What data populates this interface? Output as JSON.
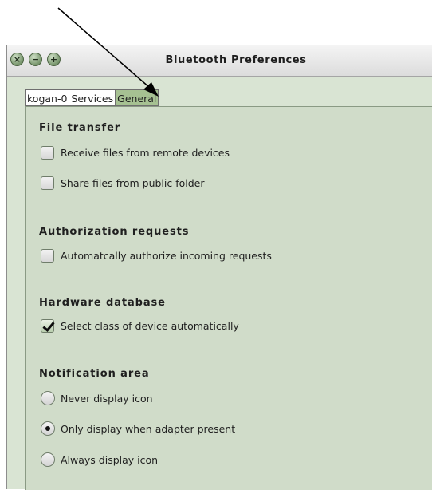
{
  "window": {
    "title": "Bluetooth Preferences",
    "buttons": {
      "close": "×",
      "minimize": "−",
      "maximize": "+"
    }
  },
  "tabs": [
    {
      "label": "kogan-0",
      "active": false
    },
    {
      "label": "Services",
      "active": false
    },
    {
      "label": "General",
      "active": true
    }
  ],
  "sections": {
    "file_transfer": {
      "title": "File transfer",
      "options": [
        {
          "label": "Receive files from remote devices",
          "checked": false
        },
        {
          "label": "Share files from public folder",
          "checked": false
        }
      ]
    },
    "authorization": {
      "title": "Authorization requests",
      "options": [
        {
          "label": "Automatcally authorize incoming requests",
          "checked": false
        }
      ]
    },
    "hardware": {
      "title": "Hardware database",
      "options": [
        {
          "label": "Select class of device automatically",
          "checked": true
        }
      ]
    },
    "notification": {
      "title": "Notification area",
      "options": [
        {
          "label": "Never display icon",
          "selected": false
        },
        {
          "label": "Only display when adapter present",
          "selected": true
        },
        {
          "label": "Always display icon",
          "selected": false
        }
      ]
    }
  },
  "colors": {
    "content_bg": "#d9e4d3",
    "active_tab": "#a6c192",
    "window_button": "#7d9a72"
  }
}
